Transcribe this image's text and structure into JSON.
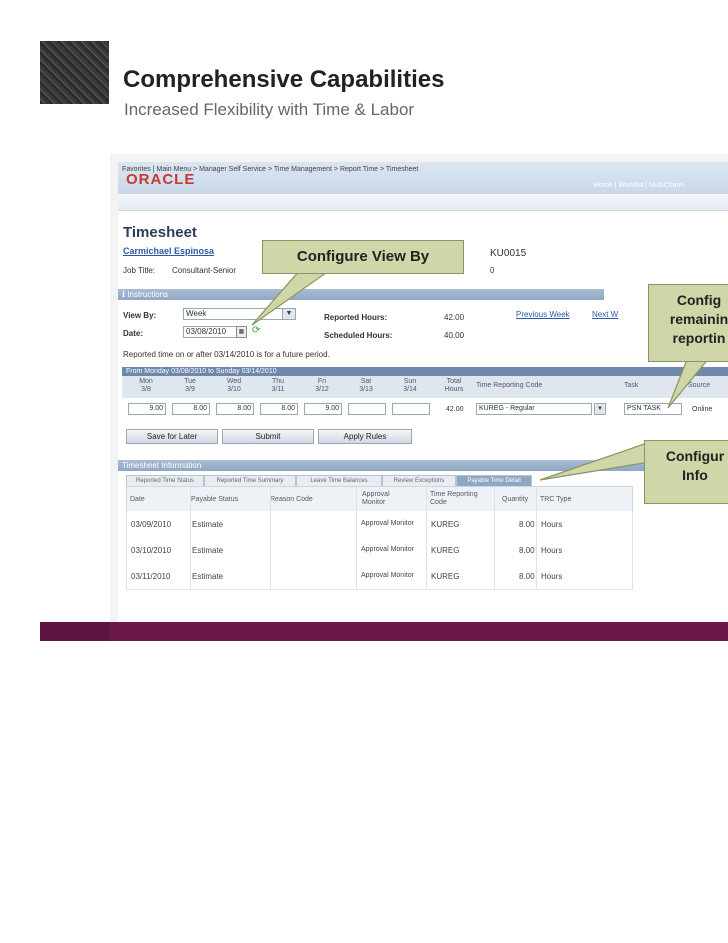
{
  "slide": {
    "title": "Comprehensive Capabilities",
    "subtitle": "Increased Flexibility with Time & Labor"
  },
  "app": {
    "logo": "ORACLE",
    "topnav": "Home   |   Worklist   |   MultiChann",
    "breadcrumb": "Favorites  |  Main Menu  > Manager Self Service > Time Management > Report Time > Timesheet"
  },
  "timesheet": {
    "title": "Timesheet",
    "employee_name": "Carmichael Espinosa",
    "job_title_label": "Job Title:",
    "job_title_value": "Consultant-Senior",
    "employee_id": "KU0015",
    "empl_record": "0",
    "instructions_label": "Instructions",
    "view_by_label": "View By:",
    "view_by_value": "Week",
    "date_label": "Date:",
    "date_value": "03/08/2010",
    "reported_hours_label": "Reported Hours:",
    "reported_hours_value": "42.00",
    "scheduled_hours_label": "Scheduled Hours:",
    "scheduled_hours_value": "40.00",
    "previous_week": "Previous Week",
    "next_week": "Next W",
    "future_note": "Reported time on or after 03/14/2010 is for a future period.",
    "period_header": "From Monday 03/08/2010 to Sunday 03/14/2010",
    "columns": [
      {
        "l1": "Mon",
        "l2": "3/8"
      },
      {
        "l1": "Tue",
        "l2": "3/9"
      },
      {
        "l1": "Wed",
        "l2": "3/10"
      },
      {
        "l1": "Thu",
        "l2": "3/11"
      },
      {
        "l1": "Fri",
        "l2": "3/12"
      },
      {
        "l1": "Sat",
        "l2": "3/13"
      },
      {
        "l1": "Sun",
        "l2": "3/14"
      },
      {
        "l1": "Total",
        "l2": "Hours"
      }
    ],
    "trc_col": "Time Reporting Code",
    "task_col": "Task",
    "source_col": "Source",
    "day_values": [
      "9.00",
      "8.00",
      "8.00",
      "8.00",
      "9.00",
      "",
      ""
    ],
    "total_value": "42.00",
    "trc_value": "KUREG - Regular",
    "task_value": "PSN TASK",
    "source_value": "Online",
    "buttons": {
      "save": "Save for Later",
      "submit": "Submit",
      "apply": "Apply Rules"
    }
  },
  "info": {
    "bar_label": "Timesheet Information",
    "tabs": [
      "Reported Time Status",
      "Reported Time Summary",
      "Leave Time Balances",
      "Review Exceptions",
      "Payable Time Detail"
    ],
    "headers": {
      "date": "Date",
      "payable_status": "Payable Status",
      "reason_code": "Reason Code",
      "approval_monitor_1": "Approval",
      "approval_monitor_2": "Monitor",
      "trc_1": "Time Reporting",
      "trc_2": "Code",
      "quantity": "Quantity",
      "trc_type": "TRC Type"
    },
    "rows": [
      {
        "date": "03/09/2010",
        "status": "Estimate",
        "monitor": "Approval Monitor",
        "trc": "KUREG",
        "qty": "8.00",
        "type": "Hours"
      },
      {
        "date": "03/10/2010",
        "status": "Estimate",
        "monitor": "Approval Monitor",
        "trc": "KUREG",
        "qty": "8.00",
        "type": "Hours"
      },
      {
        "date": "03/11/2010",
        "status": "Estimate",
        "monitor": "Approval Monitor",
        "trc": "KUREG",
        "qty": "8.00",
        "type": "Hours"
      }
    ]
  },
  "callouts": {
    "view_by": "Configure View By",
    "remaining_1": "Config",
    "remaining_2": "remainin",
    "remaining_3": "reportin",
    "info_1": "Configur",
    "info_2": "Info"
  },
  "colors": {
    "band": "#6b1a47",
    "callout_fill": "#cfd6a8",
    "header_bar": "#8ea7c4"
  }
}
